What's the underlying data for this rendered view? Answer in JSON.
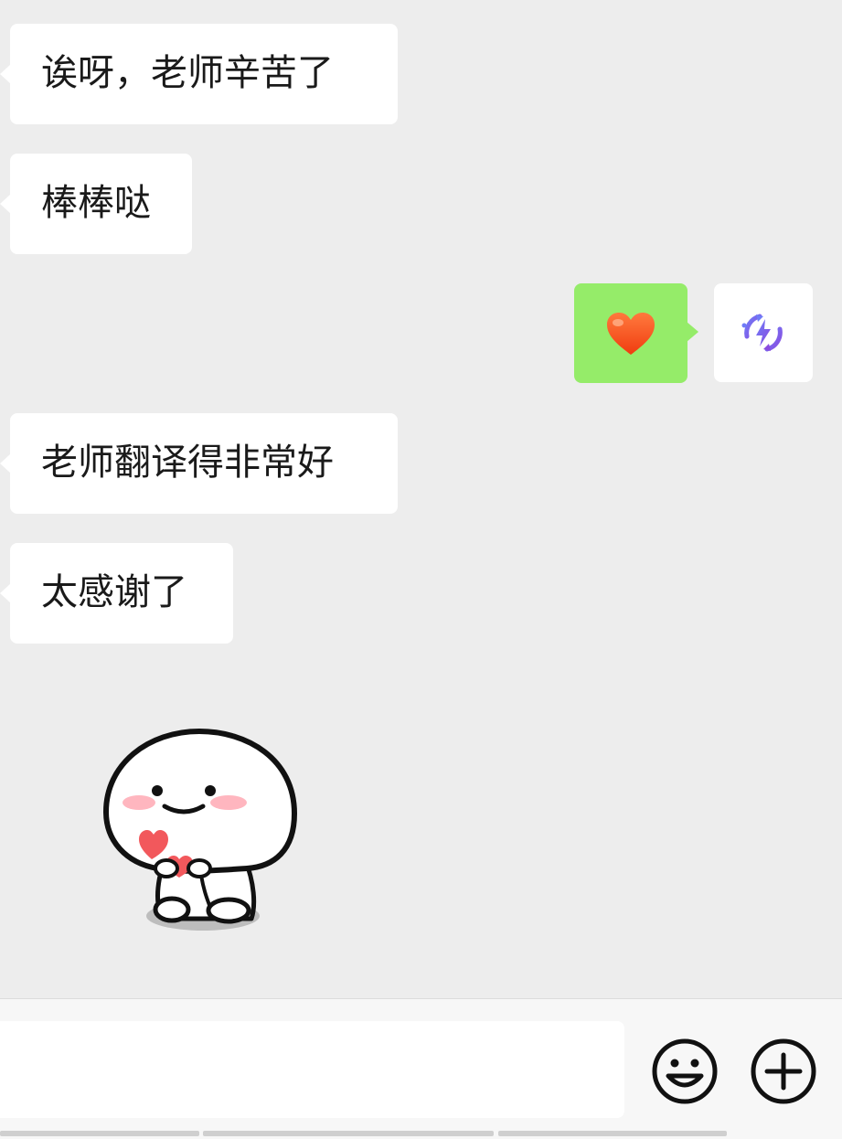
{
  "messages": {
    "m1": "诶呀，老师辛苦了",
    "m2": "棒棒哒",
    "m3_emoji": "❤️",
    "m4": "老师翻译得非常好",
    "m5": "太感谢了"
  },
  "icons": {
    "avatar": "lightning-refresh-icon",
    "sticker": "white-blob-holding-hearts-sticker",
    "emoji_button": "smiley-face-icon",
    "more_button": "plus-circle-icon"
  },
  "colors": {
    "background": "#ededed",
    "bubble_incoming": "#ffffff",
    "bubble_outgoing": "#95ec69",
    "heart": "#ff5a36"
  },
  "input": {
    "value": "",
    "placeholder": ""
  }
}
